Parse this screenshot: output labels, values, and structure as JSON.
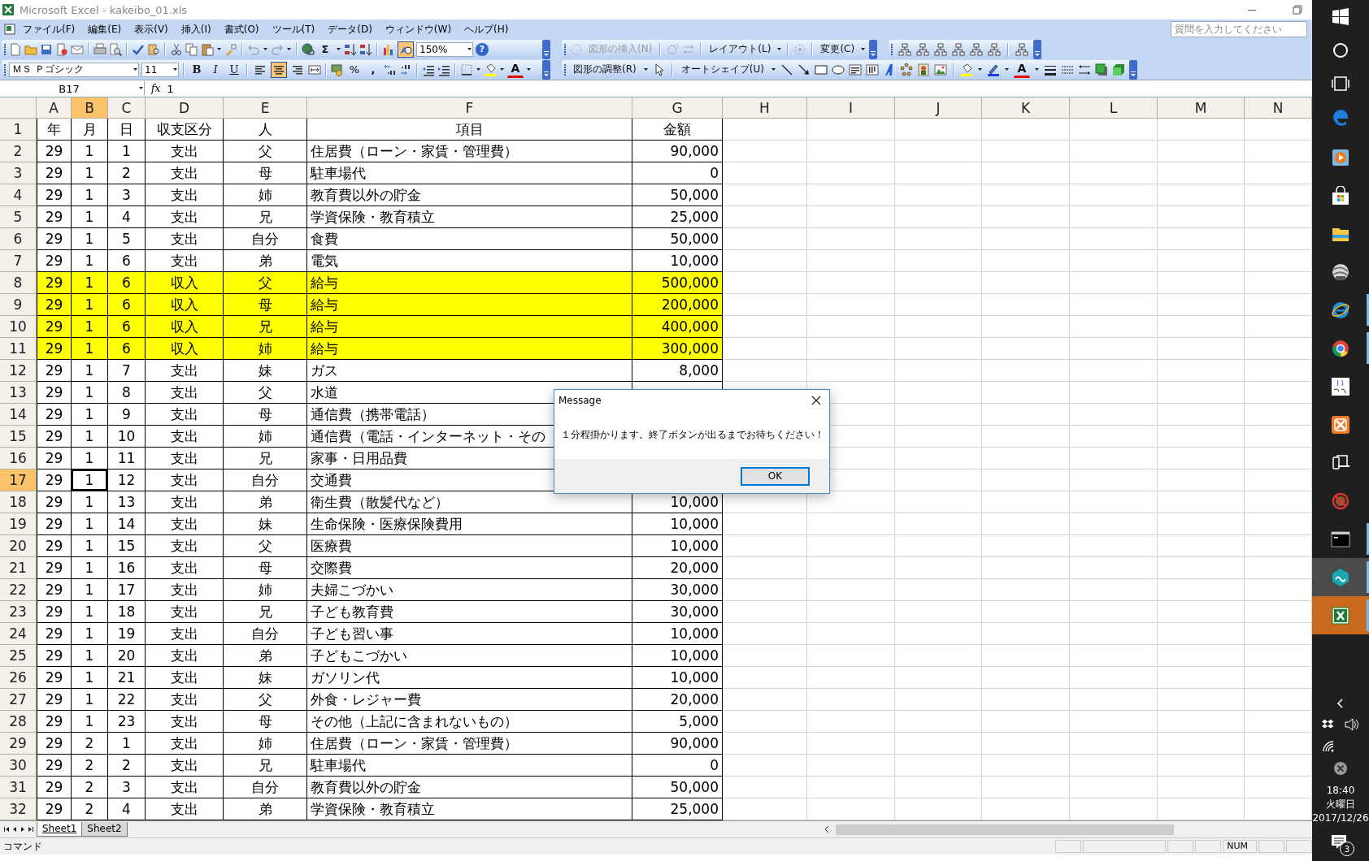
{
  "title_bar": {
    "title": "Microsoft Excel - kakeibo_01.xls"
  },
  "menu_bar": {
    "items": [
      "ファイル(F)",
      "編集(E)",
      "表示(V)",
      "挿入(I)",
      "書式(O)",
      "ツール(T)",
      "データ(D)",
      "ウィンドウ(W)",
      "ヘルプ(H)"
    ]
  },
  "help_search": {
    "placeholder": "質問を入力してください"
  },
  "standard_toolbar": {
    "autosum": "Σ",
    "drawing_selected": true,
    "zoom": "150%",
    "help": "?"
  },
  "diagram_toolbar": {
    "items": [
      {
        "label": "図形の挿入(N)",
        "disabled": true
      },
      {
        "label": "レイアウト(L)",
        "disabled": false
      },
      {
        "label": "変更(C)",
        "disabled": false
      }
    ]
  },
  "formatting_toolbar": {
    "font": "ＭＳ Ｐゴシック",
    "size": "11",
    "bold": "B",
    "italic": "I",
    "underline": "U",
    "align": [
      {
        "selected": false
      },
      {
        "selected": true
      },
      {
        "selected": false
      }
    ],
    "percent": "%",
    "comma": ",",
    "font_color": "A"
  },
  "drawing_toolbar": {
    "items": [
      "図形の調整(R)",
      "オートシェイプ(U)"
    ],
    "font_color": "A"
  },
  "formula_bar": {
    "name_box": "B17",
    "fx": "fx",
    "value": "1"
  },
  "sheet": {
    "columns": [
      {
        "label": "A",
        "selected": false
      },
      {
        "label": "B",
        "selected": true
      },
      {
        "label": "C",
        "selected": false
      },
      {
        "label": "D",
        "selected": false
      },
      {
        "label": "E",
        "selected": false
      },
      {
        "label": "F",
        "selected": false
      },
      {
        "label": "G",
        "selected": false
      },
      {
        "label": "H",
        "selected": false
      },
      {
        "label": "I",
        "selected": false
      },
      {
        "label": "J",
        "selected": false
      },
      {
        "label": "K",
        "selected": false
      },
      {
        "label": "L",
        "selected": false
      },
      {
        "label": "M",
        "selected": false
      },
      {
        "label": "N",
        "selected": false
      }
    ],
    "rows": [
      {
        "number": "1",
        "kind": "header",
        "selected": false,
        "highlighted": false,
        "cells": [
          "年",
          "月",
          "日",
          "収支区分",
          "人",
          "項目",
          "金額"
        ]
      },
      {
        "number": "2",
        "kind": "record",
        "selected": false,
        "highlighted": false,
        "cells": [
          "29",
          "1",
          "1",
          "支出",
          "父",
          "住居費（ローン・家賃・管理費）",
          "90,000"
        ]
      },
      {
        "number": "3",
        "kind": "record",
        "selected": false,
        "highlighted": false,
        "cells": [
          "29",
          "1",
          "2",
          "支出",
          "母",
          "駐車場代",
          "0"
        ]
      },
      {
        "number": "4",
        "kind": "record",
        "selected": false,
        "highlighted": false,
        "cells": [
          "29",
          "1",
          "3",
          "支出",
          "姉",
          "教育費以外の貯金",
          "50,000"
        ]
      },
      {
        "number": "5",
        "kind": "record",
        "selected": false,
        "highlighted": false,
        "cells": [
          "29",
          "1",
          "4",
          "支出",
          "兄",
          "学資保険・教育積立",
          "25,000"
        ]
      },
      {
        "number": "6",
        "kind": "record",
        "selected": false,
        "highlighted": false,
        "cells": [
          "29",
          "1",
          "5",
          "支出",
          "自分",
          "食費",
          "50,000"
        ]
      },
      {
        "number": "7",
        "kind": "record",
        "selected": false,
        "highlighted": false,
        "cells": [
          "29",
          "1",
          "6",
          "支出",
          "弟",
          "電気",
          "10,000"
        ]
      },
      {
        "number": "8",
        "kind": "record",
        "selected": false,
        "highlighted": true,
        "cells": [
          "29",
          "1",
          "6",
          "収入",
          "父",
          "給与",
          "500,000"
        ]
      },
      {
        "number": "9",
        "kind": "record",
        "selected": false,
        "highlighted": true,
        "cells": [
          "29",
          "1",
          "6",
          "収入",
          "母",
          "給与",
          "200,000"
        ]
      },
      {
        "number": "10",
        "kind": "record",
        "selected": false,
        "highlighted": true,
        "cells": [
          "29",
          "1",
          "6",
          "収入",
          "兄",
          "給与",
          "400,000"
        ]
      },
      {
        "number": "11",
        "kind": "record",
        "selected": false,
        "highlighted": true,
        "cells": [
          "29",
          "1",
          "6",
          "収入",
          "姉",
          "給与",
          "300,000"
        ]
      },
      {
        "number": "12",
        "kind": "record",
        "selected": false,
        "highlighted": false,
        "cells": [
          "29",
          "1",
          "7",
          "支出",
          "妹",
          "ガス",
          "8,000"
        ]
      },
      {
        "number": "13",
        "kind": "record",
        "selected": false,
        "highlighted": false,
        "cells": [
          "29",
          "1",
          "8",
          "支出",
          "父",
          "水道"
        ]
      },
      {
        "number": "14",
        "kind": "record",
        "selected": false,
        "highlighted": false,
        "cells": [
          "29",
          "1",
          "9",
          "支出",
          "母",
          "通信費（携帯電話）"
        ]
      },
      {
        "number": "15",
        "kind": "record",
        "selected": false,
        "highlighted": false,
        "cells": [
          "29",
          "1",
          "10",
          "支出",
          "姉",
          "通信費（電話・インターネット・その"
        ]
      },
      {
        "number": "16",
        "kind": "record",
        "selected": false,
        "highlighted": false,
        "cells": [
          "29",
          "1",
          "11",
          "支出",
          "兄",
          "家事・日用品費"
        ]
      },
      {
        "number": "17",
        "kind": "record",
        "selected": true,
        "highlighted": false,
        "cells": [
          "29",
          "1",
          "12",
          "支出",
          "自分",
          "交通費"
        ]
      },
      {
        "number": "18",
        "kind": "record",
        "selected": false,
        "highlighted": false,
        "cells": [
          "29",
          "1",
          "13",
          "支出",
          "弟",
          "衛生費（散髪代など）",
          "10,000"
        ]
      },
      {
        "number": "19",
        "kind": "record",
        "selected": false,
        "highlighted": false,
        "cells": [
          "29",
          "1",
          "14",
          "支出",
          "妹",
          "生命保険・医療保険費用",
          "10,000"
        ]
      },
      {
        "number": "20",
        "kind": "record",
        "selected": false,
        "highlighted": false,
        "cells": [
          "29",
          "1",
          "15",
          "支出",
          "父",
          "医療費",
          "10,000"
        ]
      },
      {
        "number": "21",
        "kind": "record",
        "selected": false,
        "highlighted": false,
        "cells": [
          "29",
          "1",
          "16",
          "支出",
          "母",
          "交際費",
          "20,000"
        ]
      },
      {
        "number": "22",
        "kind": "record",
        "selected": false,
        "highlighted": false,
        "cells": [
          "29",
          "1",
          "17",
          "支出",
          "姉",
          "夫婦こづかい",
          "30,000"
        ]
      },
      {
        "number": "23",
        "kind": "record",
        "selected": false,
        "highlighted": false,
        "cells": [
          "29",
          "1",
          "18",
          "支出",
          "兄",
          "子ども教育費",
          "30,000"
        ]
      },
      {
        "number": "24",
        "kind": "record",
        "selected": false,
        "highlighted": false,
        "cells": [
          "29",
          "1",
          "19",
          "支出",
          "自分",
          "子ども習い事",
          "10,000"
        ]
      },
      {
        "number": "25",
        "kind": "record",
        "selected": false,
        "highlighted": false,
        "cells": [
          "29",
          "1",
          "20",
          "支出",
          "弟",
          "子どもこづかい",
          "10,000"
        ]
      },
      {
        "number": "26",
        "kind": "record",
        "selected": false,
        "highlighted": false,
        "cells": [
          "29",
          "1",
          "21",
          "支出",
          "妹",
          "ガソリン代",
          "10,000"
        ]
      },
      {
        "number": "27",
        "kind": "record",
        "selected": false,
        "highlighted": false,
        "cells": [
          "29",
          "1",
          "22",
          "支出",
          "父",
          "外食・レジャー費",
          "20,000"
        ]
      },
      {
        "number": "28",
        "kind": "record",
        "selected": false,
        "highlighted": false,
        "cells": [
          "29",
          "1",
          "23",
          "支出",
          "母",
          "その他（上記に含まれないもの）",
          "5,000"
        ]
      },
      {
        "number": "29",
        "kind": "record",
        "selected": false,
        "highlighted": false,
        "cells": [
          "29",
          "2",
          "1",
          "支出",
          "姉",
          "住居費（ローン・家賃・管理費）",
          "90,000"
        ]
      },
      {
        "number": "30",
        "kind": "record",
        "selected": false,
        "highlighted": false,
        "cells": [
          "29",
          "2",
          "2",
          "支出",
          "兄",
          "駐車場代",
          "0"
        ]
      },
      {
        "number": "31",
        "kind": "record",
        "selected": false,
        "highlighted": false,
        "cells": [
          "29",
          "2",
          "3",
          "支出",
          "自分",
          "教育費以外の貯金",
          "50,000"
        ]
      },
      {
        "number": "32",
        "kind": "record",
        "selected": false,
        "highlighted": false,
        "cells": [
          "29",
          "2",
          "4",
          "支出",
          "弟",
          "学資保険・教育積立",
          "25,000"
        ]
      }
    ]
  },
  "dialog": {
    "title": "Message",
    "message": "１分程掛かります。終了ボタンが出るまでお待ちください！",
    "button": "OK"
  },
  "sheet_tabs": [
    {
      "label": "Sheet1",
      "selected": true
    },
    {
      "label": "Sheet2",
      "selected": false
    }
  ],
  "status_bar": {
    "mode": "コマンド",
    "num": "NUM"
  },
  "taskbar": {
    "apps": [
      {
        "kind": "edge",
        "running": false,
        "selected": false,
        "flashing": false
      },
      {
        "kind": "media",
        "running": false,
        "selected": false,
        "flashing": false
      },
      {
        "kind": "store",
        "running": false,
        "selected": false,
        "flashing": false
      },
      {
        "kind": "folder",
        "running": false,
        "selected": false,
        "flashing": false
      },
      {
        "kind": "globe",
        "running": false,
        "selected": false,
        "flashing": false
      },
      {
        "kind": "ie",
        "running": true,
        "selected": false,
        "flashing": false
      },
      {
        "kind": "chrome",
        "running": true,
        "selected": false,
        "flashing": false
      },
      {
        "kind": "kana",
        "running": false,
        "selected": false,
        "flashing": false
      },
      {
        "kind": "xampp",
        "running": false,
        "selected": false,
        "flashing": false
      },
      {
        "kind": "devices",
        "running": false,
        "selected": false,
        "flashing": false
      },
      {
        "kind": "blocked",
        "running": false,
        "selected": false,
        "flashing": false
      },
      {
        "kind": "console",
        "running": true,
        "selected": false,
        "flashing": false
      },
      {
        "kind": "hexagon",
        "running": true,
        "selected": true,
        "flashing": false
      },
      {
        "kind": "excel",
        "running": true,
        "selected": false,
        "flashing": true
      }
    ],
    "clock": {
      "time": "18:40",
      "day": "火曜日",
      "date": "2017/12/26"
    },
    "notifications": "3"
  }
}
